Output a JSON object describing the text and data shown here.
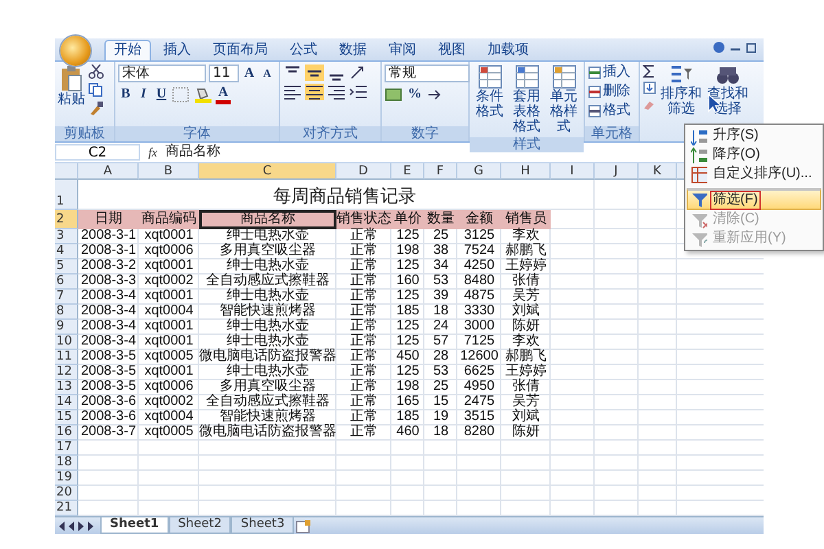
{
  "ribbon": {
    "tabs": [
      {
        "label": "开始",
        "selected": true
      },
      {
        "label": "插入",
        "selected": false
      },
      {
        "label": "页面布局",
        "selected": false
      },
      {
        "label": "公式",
        "selected": false
      },
      {
        "label": "数据",
        "selected": false
      },
      {
        "label": "审阅",
        "selected": false
      },
      {
        "label": "视图",
        "selected": false
      },
      {
        "label": "加载项",
        "selected": false
      }
    ],
    "clipboard": {
      "label": "剪贴板",
      "paste": "粘贴"
    },
    "font": {
      "label": "字体",
      "name": "宋体",
      "size": "11",
      "bold": "B",
      "italic": "I",
      "underline": "U",
      "color_letter": "A",
      "grow": "A",
      "shrink": "A"
    },
    "alignment": {
      "label": "对齐方式"
    },
    "number": {
      "label": "数字",
      "format": "常规",
      "percent": "%"
    },
    "styles": {
      "label": "样式",
      "buttons": [
        "条件格式",
        "套用表格格式",
        "单元格样式"
      ]
    },
    "cells": {
      "label": "单元格",
      "buttons": [
        "插入",
        "删除",
        "格式"
      ]
    },
    "editing": {
      "buttons": [
        "排序和筛选",
        "查找和选择"
      ]
    }
  },
  "formula_bar": {
    "name_box": "C2",
    "fx": "fx",
    "content": "商品名称"
  },
  "sort_menu": [
    {
      "label": "升序(S)",
      "disabled": false,
      "selected": false,
      "separator_before": false
    },
    {
      "label": "降序(O)",
      "disabled": false,
      "selected": false,
      "separator_before": false
    },
    {
      "label": "自定义排序(U)...",
      "disabled": false,
      "selected": false,
      "separator_before": false
    },
    {
      "label": "筛选(F)",
      "disabled": false,
      "selected": true,
      "separator_before": true
    },
    {
      "label": "清除(C)",
      "disabled": true,
      "selected": false,
      "separator_before": false
    },
    {
      "label": "重新应用(Y)",
      "disabled": true,
      "selected": false,
      "separator_before": false
    }
  ],
  "sheet": {
    "columns": [
      {
        "letter": "A",
        "selected": false
      },
      {
        "letter": "B",
        "selected": false
      },
      {
        "letter": "C",
        "selected": true
      },
      {
        "letter": "D",
        "selected": false
      },
      {
        "letter": "E",
        "selected": false
      },
      {
        "letter": "F",
        "selected": false
      },
      {
        "letter": "G",
        "selected": false
      },
      {
        "letter": "H",
        "selected": false
      },
      {
        "letter": "I",
        "selected": false
      },
      {
        "letter": "J",
        "selected": false
      },
      {
        "letter": "K",
        "selected": false
      }
    ],
    "rows": [
      {
        "number": "1",
        "kind": "title",
        "selected": false,
        "text": "每周商品销售记录"
      },
      {
        "number": "2",
        "kind": "header",
        "selected": true,
        "cells": [
          "日期",
          "商品编码",
          "商品名称",
          "销售状态",
          "单价",
          "数量",
          "金额",
          "销售员"
        ]
      },
      {
        "number": "3",
        "kind": "data",
        "selected": false,
        "cells": [
          "2008-3-1",
          "xqt0001",
          "绅士电热水壶",
          "正常",
          "125",
          "25",
          "3125",
          "李欢"
        ]
      },
      {
        "number": "4",
        "kind": "data",
        "selected": false,
        "cells": [
          "2008-3-1",
          "xqt0006",
          "多用真空吸尘器",
          "正常",
          "198",
          "38",
          "7524",
          "郝鹏飞"
        ]
      },
      {
        "number": "5",
        "kind": "data",
        "selected": false,
        "cells": [
          "2008-3-2",
          "xqt0001",
          "绅士电热水壶",
          "正常",
          "125",
          "34",
          "4250",
          "王婷婷"
        ]
      },
      {
        "number": "6",
        "kind": "data",
        "selected": false,
        "cells": [
          "2008-3-3",
          "xqt0002",
          "全自动感应式擦鞋器",
          "正常",
          "160",
          "53",
          "8480",
          "张倩"
        ]
      },
      {
        "number": "7",
        "kind": "data",
        "selected": false,
        "cells": [
          "2008-3-4",
          "xqt0001",
          "绅士电热水壶",
          "正常",
          "125",
          "39",
          "4875",
          "吴芳"
        ]
      },
      {
        "number": "8",
        "kind": "data",
        "selected": false,
        "cells": [
          "2008-3-4",
          "xqt0004",
          "智能快速煎烤器",
          "正常",
          "185",
          "18",
          "3330",
          "刘斌"
        ]
      },
      {
        "number": "9",
        "kind": "data",
        "selected": false,
        "cells": [
          "2008-3-4",
          "xqt0001",
          "绅士电热水壶",
          "正常",
          "125",
          "24",
          "3000",
          "陈妍"
        ]
      },
      {
        "number": "10",
        "kind": "data",
        "selected": false,
        "cells": [
          "2008-3-4",
          "xqt0001",
          "绅士电热水壶",
          "正常",
          "125",
          "57",
          "7125",
          "李欢"
        ]
      },
      {
        "number": "11",
        "kind": "data",
        "selected": false,
        "cells": [
          "2008-3-5",
          "xqt0005",
          "微电脑电话防盗报警器",
          "正常",
          "450",
          "28",
          "12600",
          "郝鹏飞"
        ]
      },
      {
        "number": "12",
        "kind": "data",
        "selected": false,
        "cells": [
          "2008-3-5",
          "xqt0001",
          "绅士电热水壶",
          "正常",
          "125",
          "53",
          "6625",
          "王婷婷"
        ]
      },
      {
        "number": "13",
        "kind": "data",
        "selected": false,
        "cells": [
          "2008-3-5",
          "xqt0006",
          "多用真空吸尘器",
          "正常",
          "198",
          "25",
          "4950",
          "张倩"
        ]
      },
      {
        "number": "14",
        "kind": "data",
        "selected": false,
        "cells": [
          "2008-3-6",
          "xqt0002",
          "全自动感应式擦鞋器",
          "正常",
          "165",
          "15",
          "2475",
          "吴芳"
        ]
      },
      {
        "number": "15",
        "kind": "data",
        "selected": false,
        "cells": [
          "2008-3-6",
          "xqt0004",
          "智能快速煎烤器",
          "正常",
          "185",
          "19",
          "3515",
          "刘斌"
        ]
      },
      {
        "number": "16",
        "kind": "data",
        "selected": false,
        "cells": [
          "2008-3-7",
          "xqt0005",
          "微电脑电话防盗报警器",
          "正常",
          "460",
          "18",
          "8280",
          "陈妍"
        ]
      },
      {
        "number": "17",
        "kind": "empty",
        "selected": false
      },
      {
        "number": "18",
        "kind": "empty",
        "selected": false
      },
      {
        "number": "19",
        "kind": "empty",
        "selected": false
      },
      {
        "number": "20",
        "kind": "empty",
        "selected": false
      },
      {
        "number": "21",
        "kind": "empty",
        "selected": false
      }
    ]
  },
  "sheet_tabs": [
    {
      "label": "Sheet1",
      "selected": true
    },
    {
      "label": "Sheet2",
      "selected": false
    },
    {
      "label": "Sheet3",
      "selected": false
    }
  ]
}
